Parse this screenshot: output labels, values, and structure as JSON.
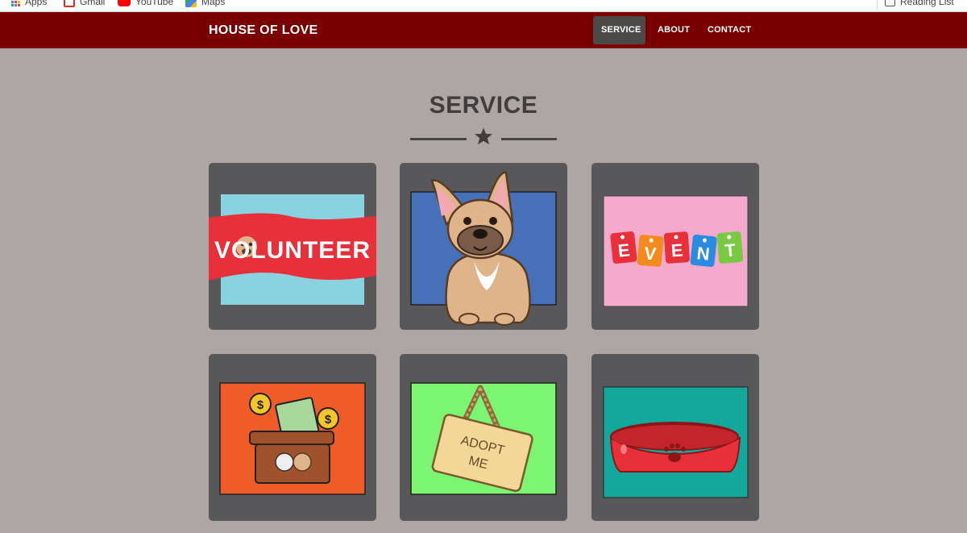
{
  "browser": {
    "bookmarks": [
      {
        "label": "Apps",
        "icon": "apps-grid-icon"
      },
      {
        "label": "Gmail",
        "icon": "gmail-icon"
      },
      {
        "label": "YouTube",
        "icon": "youtube-icon"
      },
      {
        "label": "Maps",
        "icon": "maps-icon"
      }
    ],
    "reading_list": {
      "label": "Reading List",
      "icon": "reading-list-icon"
    }
  },
  "navbar": {
    "brand": "HOUSE OF LOVE",
    "items": [
      {
        "label": "SERVICE",
        "active": true
      },
      {
        "label": "ABOUT",
        "active": false
      },
      {
        "label": "CONTACT",
        "active": false
      }
    ],
    "background": "#7a0000"
  },
  "section": {
    "title": "SERVICE",
    "divider_icon": "star-icon"
  },
  "services": [
    {
      "id": "volunteer",
      "image_text": "VOLUNTEER",
      "icon": "volunteer-banner-image"
    },
    {
      "id": "adopt-dog",
      "icon": "french-bulldog-image"
    },
    {
      "id": "event",
      "image_letters": [
        "E",
        "V",
        "E",
        "N",
        "T"
      ],
      "icon": "event-tags-image"
    },
    {
      "id": "donate",
      "icon": "donation-box-image"
    },
    {
      "id": "adopt-me",
      "image_text_lines": [
        "ADOPT",
        "ME"
      ],
      "icon": "adopt-me-sign-image"
    },
    {
      "id": "supplies",
      "icon": "pet-bowl-image"
    }
  ],
  "colors": {
    "page_background": "#aea5a5",
    "card_background": "#58575a",
    "title": "#3f3d3d",
    "nav_active": "#4d4a4a"
  }
}
